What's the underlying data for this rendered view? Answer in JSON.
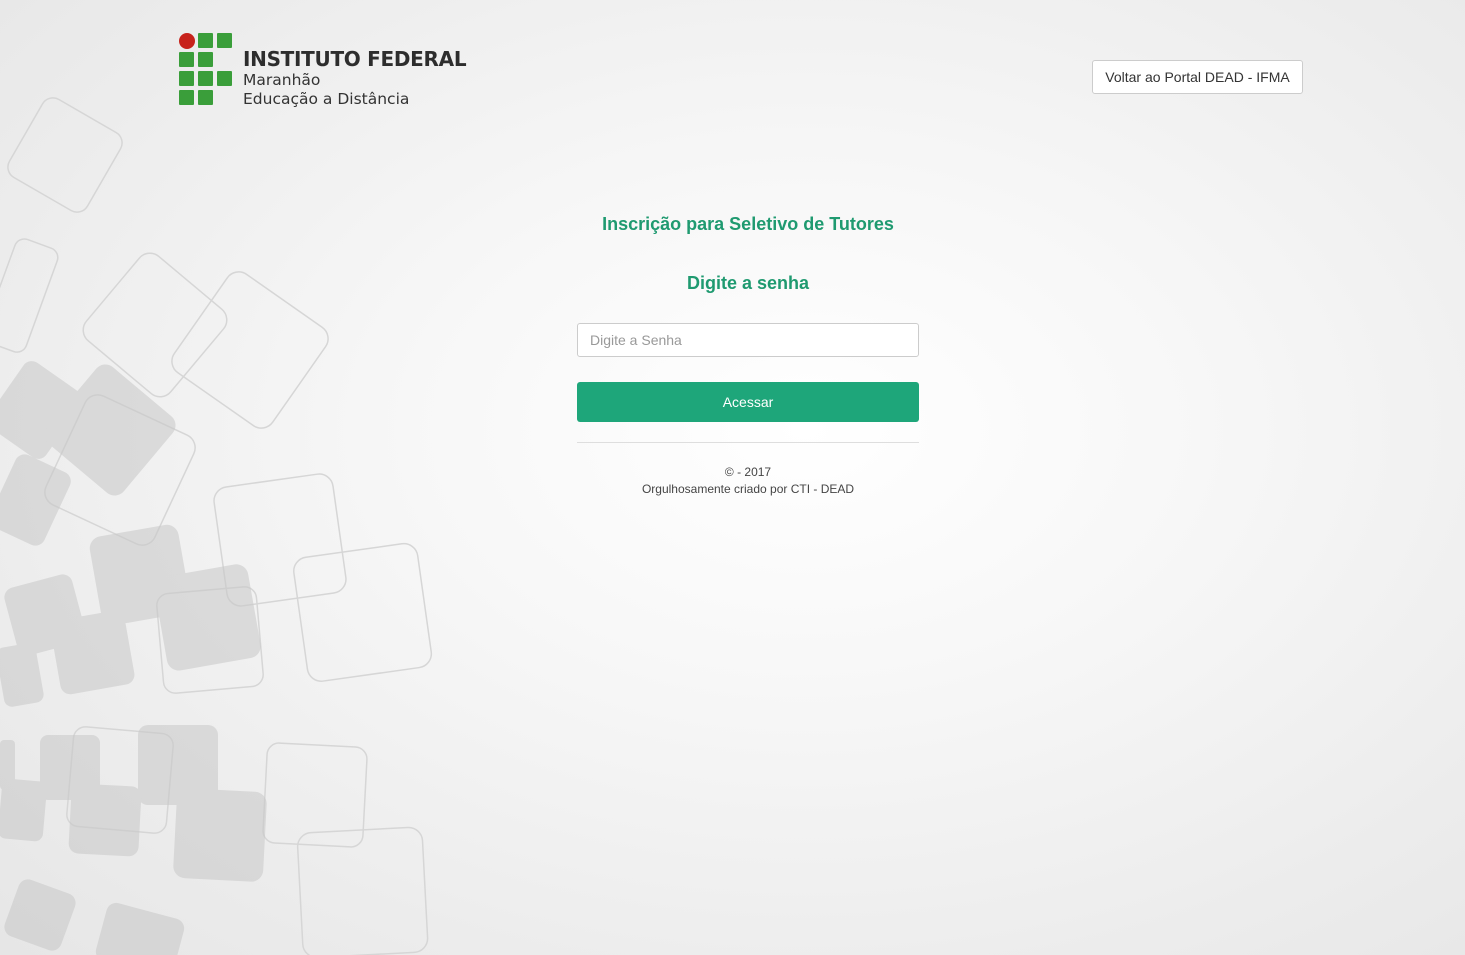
{
  "header": {
    "logo": {
      "title": "INSTITUTO FEDERAL",
      "line1": "Maranhão",
      "line2": "Educação a Distância"
    },
    "back_button": "Voltar ao Portal DEAD - IFMA"
  },
  "form": {
    "title": "Inscrição para Seletivo de Tutores",
    "subtitle": "Digite a senha",
    "password_placeholder": "Digite a Senha",
    "password_value": "",
    "submit_label": "Acessar"
  },
  "footer": {
    "copyright": "© - 2017",
    "credit": "Orgulhosamente criado por CTI - DEAD"
  },
  "colors": {
    "accent": "#1ea67a",
    "title_text": "#1f9a70",
    "logo_green": "#3a9e3a",
    "logo_red": "#c7221b"
  }
}
